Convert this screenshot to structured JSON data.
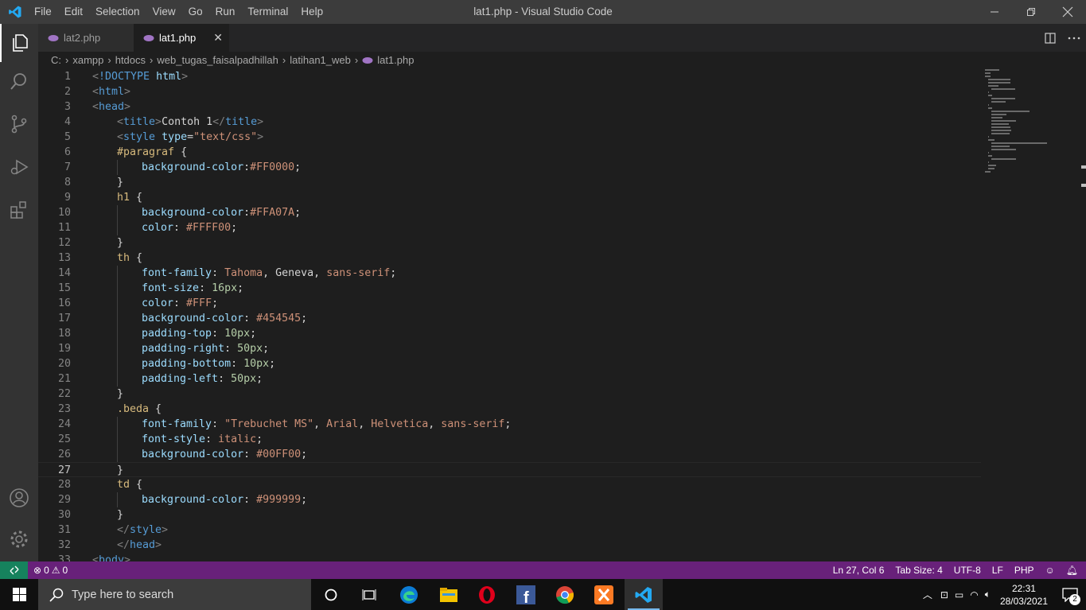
{
  "window": {
    "title": "lat1.php - Visual Studio Code"
  },
  "menu": [
    "File",
    "Edit",
    "Selection",
    "View",
    "Go",
    "Run",
    "Terminal",
    "Help"
  ],
  "tabs": [
    {
      "label": "lat2.php",
      "active": false
    },
    {
      "label": "lat1.php",
      "active": true
    }
  ],
  "breadcrumb": [
    "C:",
    "xampp",
    "htdocs",
    "web_tugas_faisalpadhillah",
    "latihan1_web",
    "lat1.php"
  ],
  "code_lines": [
    {
      "n": "1",
      "indent": 0,
      "tokens": [
        [
          "punc",
          "<"
        ],
        [
          "tag",
          "!DOCTYPE"
        ],
        [
          "text",
          " "
        ],
        [
          "attr",
          "html"
        ],
        [
          "punc",
          ">"
        ]
      ]
    },
    {
      "n": "2",
      "indent": 0,
      "tokens": [
        [
          "punc",
          "<"
        ],
        [
          "tag",
          "html"
        ],
        [
          "punc",
          ">"
        ]
      ]
    },
    {
      "n": "3",
      "indent": 0,
      "tokens": [
        [
          "punc",
          "<"
        ],
        [
          "tag",
          "head"
        ],
        [
          "punc",
          ">"
        ]
      ]
    },
    {
      "n": "4",
      "indent": 1,
      "tokens": [
        [
          "punc",
          "<"
        ],
        [
          "tag",
          "title"
        ],
        [
          "punc",
          ">"
        ],
        [
          "text",
          "Contoh 1"
        ],
        [
          "punc",
          "</"
        ],
        [
          "tag",
          "title"
        ],
        [
          "punc",
          ">"
        ]
      ]
    },
    {
      "n": "5",
      "indent": 1,
      "tokens": [
        [
          "punc",
          "<"
        ],
        [
          "tag",
          "style"
        ],
        [
          "text",
          " "
        ],
        [
          "attr",
          "type"
        ],
        [
          "text",
          "="
        ],
        [
          "str",
          "\"text/css\""
        ],
        [
          "punc",
          ">"
        ]
      ]
    },
    {
      "n": "6",
      "indent": 1,
      "tokens": [
        [
          "sel",
          "#paragraf"
        ],
        [
          "text",
          " {"
        ]
      ]
    },
    {
      "n": "7",
      "indent": 2,
      "tokens": [
        [
          "prop",
          "background-color"
        ],
        [
          "text",
          ":"
        ],
        [
          "str",
          "#FF0000"
        ],
        [
          "text",
          ";"
        ]
      ]
    },
    {
      "n": "8",
      "indent": 1,
      "tokens": [
        [
          "text",
          "}"
        ]
      ]
    },
    {
      "n": "9",
      "indent": 1,
      "tokens": [
        [
          "sel",
          "h1"
        ],
        [
          "text",
          " {"
        ]
      ]
    },
    {
      "n": "10",
      "indent": 2,
      "tokens": [
        [
          "prop",
          "background-color"
        ],
        [
          "text",
          ":"
        ],
        [
          "str",
          "#FFA07A"
        ],
        [
          "text",
          ";"
        ]
      ]
    },
    {
      "n": "11",
      "indent": 2,
      "tokens": [
        [
          "prop",
          "color"
        ],
        [
          "text",
          ": "
        ],
        [
          "str",
          "#FFFF00"
        ],
        [
          "text",
          ";"
        ]
      ]
    },
    {
      "n": "12",
      "indent": 1,
      "tokens": [
        [
          "text",
          "}"
        ]
      ]
    },
    {
      "n": "13",
      "indent": 1,
      "tokens": [
        [
          "sel",
          "th"
        ],
        [
          "text",
          " {"
        ]
      ]
    },
    {
      "n": "14",
      "indent": 2,
      "tokens": [
        [
          "prop",
          "font-family"
        ],
        [
          "text",
          ": "
        ],
        [
          "str",
          "Tahoma"
        ],
        [
          "text",
          ", Geneva, "
        ],
        [
          "str",
          "sans-serif"
        ],
        [
          "text",
          ";"
        ]
      ]
    },
    {
      "n": "15",
      "indent": 2,
      "tokens": [
        [
          "prop",
          "font-size"
        ],
        [
          "text",
          ": "
        ],
        [
          "num",
          "16px"
        ],
        [
          "text",
          ";"
        ]
      ]
    },
    {
      "n": "16",
      "indent": 2,
      "tokens": [
        [
          "prop",
          "color"
        ],
        [
          "text",
          ": "
        ],
        [
          "str",
          "#FFF"
        ],
        [
          "text",
          ";"
        ]
      ]
    },
    {
      "n": "17",
      "indent": 2,
      "tokens": [
        [
          "prop",
          "background-color"
        ],
        [
          "text",
          ": "
        ],
        [
          "str",
          "#454545"
        ],
        [
          "text",
          ";"
        ]
      ]
    },
    {
      "n": "18",
      "indent": 2,
      "tokens": [
        [
          "prop",
          "padding-top"
        ],
        [
          "text",
          ": "
        ],
        [
          "num",
          "10px"
        ],
        [
          "text",
          ";"
        ]
      ]
    },
    {
      "n": "19",
      "indent": 2,
      "tokens": [
        [
          "prop",
          "padding-right"
        ],
        [
          "text",
          ": "
        ],
        [
          "num",
          "50px"
        ],
        [
          "text",
          ";"
        ]
      ]
    },
    {
      "n": "20",
      "indent": 2,
      "tokens": [
        [
          "prop",
          "padding-bottom"
        ],
        [
          "text",
          ": "
        ],
        [
          "num",
          "10px"
        ],
        [
          "text",
          ";"
        ]
      ]
    },
    {
      "n": "21",
      "indent": 2,
      "tokens": [
        [
          "prop",
          "padding-left"
        ],
        [
          "text",
          ": "
        ],
        [
          "num",
          "50px"
        ],
        [
          "text",
          ";"
        ]
      ]
    },
    {
      "n": "22",
      "indent": 1,
      "tokens": [
        [
          "text",
          "}"
        ]
      ]
    },
    {
      "n": "23",
      "indent": 1,
      "tokens": [
        [
          "sel",
          ".beda"
        ],
        [
          "text",
          " {"
        ]
      ]
    },
    {
      "n": "24",
      "indent": 2,
      "tokens": [
        [
          "prop",
          "font-family"
        ],
        [
          "text",
          ": "
        ],
        [
          "str",
          "\"Trebuchet MS\""
        ],
        [
          "text",
          ", "
        ],
        [
          "str",
          "Arial"
        ],
        [
          "text",
          ", "
        ],
        [
          "str",
          "Helvetica"
        ],
        [
          "text",
          ", "
        ],
        [
          "str",
          "sans-serif"
        ],
        [
          "text",
          ";"
        ]
      ]
    },
    {
      "n": "25",
      "indent": 2,
      "tokens": [
        [
          "prop",
          "font-style"
        ],
        [
          "text",
          ": "
        ],
        [
          "str",
          "italic"
        ],
        [
          "text",
          ";"
        ]
      ]
    },
    {
      "n": "26",
      "indent": 2,
      "tokens": [
        [
          "prop",
          "background-color"
        ],
        [
          "text",
          ": "
        ],
        [
          "str",
          "#00FF00"
        ],
        [
          "text",
          ";"
        ]
      ]
    },
    {
      "n": "27",
      "indent": 1,
      "current": true,
      "tokens": [
        [
          "text",
          "}"
        ]
      ]
    },
    {
      "n": "28",
      "indent": 1,
      "tokens": [
        [
          "sel",
          "td"
        ],
        [
          "text",
          " {"
        ]
      ]
    },
    {
      "n": "29",
      "indent": 2,
      "tokens": [
        [
          "prop",
          "background-color"
        ],
        [
          "text",
          ": "
        ],
        [
          "str",
          "#999999"
        ],
        [
          "text",
          ";"
        ]
      ]
    },
    {
      "n": "30",
      "indent": 1,
      "tokens": [
        [
          "text",
          "}"
        ]
      ]
    },
    {
      "n": "31",
      "indent": 1,
      "tokens": [
        [
          "punc",
          "</"
        ],
        [
          "tag",
          "style"
        ],
        [
          "punc",
          ">"
        ]
      ]
    },
    {
      "n": "32",
      "indent": 1,
      "tokens": [
        [
          "punc",
          "</"
        ],
        [
          "tag",
          "head"
        ],
        [
          "punc",
          ">"
        ]
      ]
    },
    {
      "n": "33",
      "indent": 0,
      "tokens": [
        [
          "punc",
          "<"
        ],
        [
          "tag",
          "body"
        ],
        [
          "punc",
          ">"
        ]
      ]
    }
  ],
  "status": {
    "errors": "0",
    "warnings": "0",
    "position": "Ln 27, Col 6",
    "tab_size": "Tab Size: 4",
    "encoding": "UTF-8",
    "eol": "LF",
    "language": "PHP"
  },
  "taskbar": {
    "search_placeholder": "Type here to search",
    "time": "22:31",
    "date": "28/03/2021",
    "notifications": "2"
  },
  "colors": {
    "statusbar": "#68217a",
    "remote": "#16825d",
    "activitybar": "#333333",
    "editor_bg": "#1e1e1e",
    "titlebar": "#3c3c3c"
  }
}
